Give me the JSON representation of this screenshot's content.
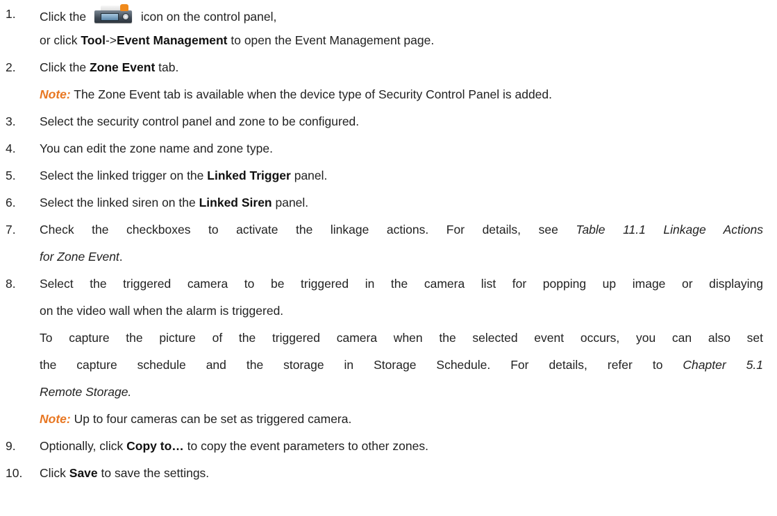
{
  "steps": [
    {
      "num": "1.",
      "pre": "Click the ",
      "icon": "control-panel-device-icon",
      "post": " icon on the control panel,",
      "line2_pre": "or click ",
      "tool": "Tool",
      "arrow": "->",
      "event_mgmt": "Event Management",
      "line2_post": " to open the Event Management page."
    },
    {
      "num": "2.",
      "pre": "Click the ",
      "bold": "Zone Event",
      "post": " tab.",
      "note_label": "Note:",
      "note_text": " The Zone Event tab is available when the device type of Security Control Panel is added."
    },
    {
      "num": "3.",
      "text": "Select the security control panel and zone to be configured."
    },
    {
      "num": "4.",
      "text": "You can edit the zone name and zone type."
    },
    {
      "num": "5.",
      "pre": "Select the linked trigger on the ",
      "bold": "Linked Trigger",
      "post": " panel."
    },
    {
      "num": "6.",
      "pre": "Select the linked siren on the ",
      "bold": "Linked Siren",
      "post": " panel."
    },
    {
      "num": "7.",
      "line1": "Check the checkboxes to activate the linkage actions. For details, see ",
      "ital1": "Table 11.1 Linkage Actions",
      "ital2": "for Zone Event",
      "post": "."
    },
    {
      "num": "8.",
      "line1": "Select the triggered camera to be triggered in the camera list for popping up image or displaying",
      "line2": "on the video wall when the alarm is triggered.",
      "line3": "To capture the picture of the triggered camera when the selected event occurs, you can also set",
      "line4_pre": "the capture schedule and the storage in Storage Schedule. For details, refer to ",
      "line4_ital": "Chapter 5.1",
      "line5_ital": "Remote Storage.",
      "note_label": "Note:",
      "note_text": " Up to four cameras can be set as triggered camera."
    },
    {
      "num": "9.",
      "pre": "Optionally, click ",
      "bold": "Copy to…",
      "post": " to copy the event parameters to other zones."
    },
    {
      "num": "10.",
      "pre": "Click ",
      "bold": "Save",
      "post": " to save the settings."
    }
  ],
  "colors": {
    "note": "#e87722",
    "text": "#222222"
  }
}
